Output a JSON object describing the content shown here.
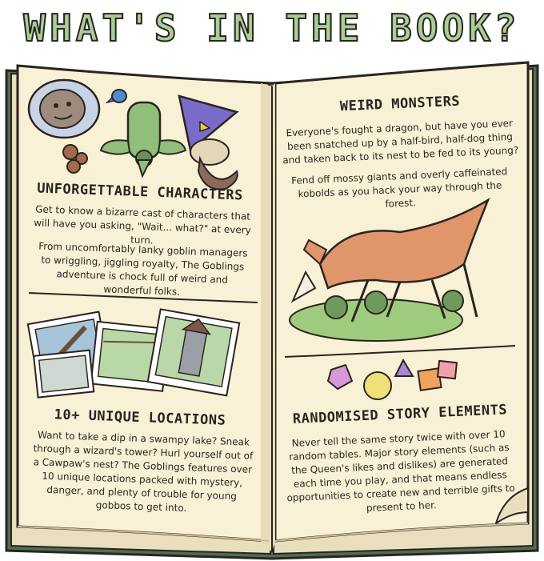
{
  "title": "WHAT'S IN THE BOOK?",
  "colors": {
    "title_fill": "#a8cf97",
    "page": "#f8f1d6",
    "book_cover": "#4f6e53",
    "ink": "#2b2420"
  },
  "left_page": {
    "characters": {
      "heading": "UNFORGETTABLE CHARACTERS",
      "para1": "Get to know a bizarre cast of characters that will have you asking, \"Wait... what?\" at every turn.",
      "para2": "From uncomfortably lanky goblin managers to wriggling, jiggling royalty, The Goblings adventure is chock full of weird and wonderful folks."
    },
    "locations": {
      "heading": "10+ UNIQUE LOCATIONS",
      "para": "Want to take a dip in a swampy lake? Sneak through a wizard's tower? Hurl yourself out of a Cawpaw's nest? The Goblings features over 10 unique locations packed with mystery, danger, and plenty of trouble for young gobbos to get into."
    }
  },
  "right_page": {
    "monsters": {
      "heading": "WEIRD MONSTERS",
      "para1": "Everyone's fought a dragon, but have you ever been snatched up by a half-bird, half-dog thing and taken back to its nest to be fed to its young?",
      "para2": "Fend off mossy giants and overly caffeinated kobolds as you hack your way through the forest."
    },
    "story": {
      "heading": "RANDOMISED STORY ELEMENTS",
      "para": "Never tell the same story twice with over 10 random tables. Major story elements (such as the Queen's likes and dislikes) are generated each time you play, and that means endless opportunities to create new and terrible gifts to present to her."
    }
  },
  "icons": [
    "goblin-king-portrait-icon",
    "blue-bird-icon",
    "green-goblin-icon",
    "wizard-goblin-icon",
    "location-photos-icon",
    "cawpaw-monster-icon",
    "dice-set-icon"
  ]
}
